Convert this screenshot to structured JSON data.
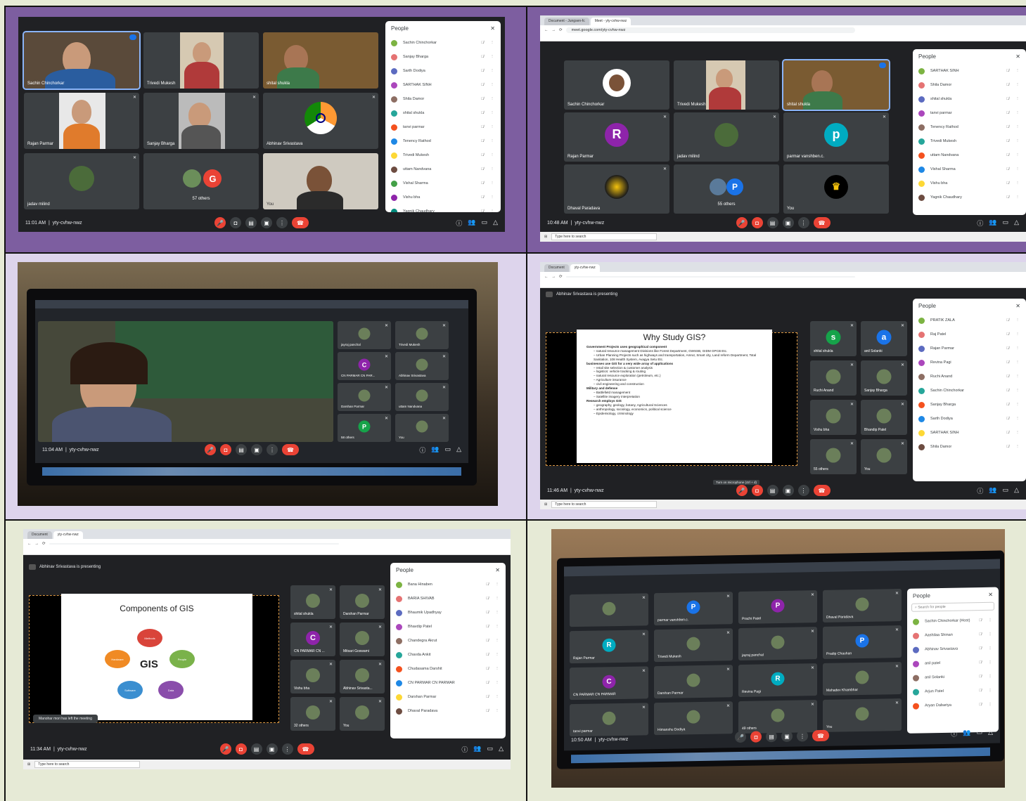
{
  "panel1": {
    "clock": "11:01 AM",
    "code": "yty-cvhw-nwz",
    "tiles": [
      {
        "name": "Sachin Chinchorkar"
      },
      {
        "name": "Trivedi Mukesh"
      },
      {
        "name": "shital shukla"
      },
      {
        "name": "Rajan Parmar"
      },
      {
        "name": "Sanjay Bharga"
      },
      {
        "name": "Abhinav Srivastava"
      },
      {
        "name": "jadav milind"
      },
      {
        "name": "57 others",
        "letter": "G"
      },
      {
        "name": "You"
      }
    ],
    "people_title": "People",
    "people": [
      {
        "name": "Sachin Chinchorkar"
      },
      {
        "name": "Sanjay Bharga"
      },
      {
        "name": "Sarth Dodiya"
      },
      {
        "name": "SARTHAK SINH"
      },
      {
        "name": "Shila Damor"
      },
      {
        "name": "shital shukla"
      },
      {
        "name": "tanvi parmar"
      },
      {
        "name": "Tenency Rathod"
      },
      {
        "name": "Trivedi Mukesh"
      },
      {
        "name": "uttam Nandvana"
      },
      {
        "name": "Vishal Sharma"
      },
      {
        "name": "Vishu bha"
      },
      {
        "name": "Yagnik Chaudhary"
      }
    ]
  },
  "panel2": {
    "clock": "10:48 AM",
    "code": "yty-cvhw-nwz",
    "tab1": "Document - Jungsen-fc",
    "tab2": "Meet - yty-cvhw-nwz",
    "url": "meet.google.com/yty-cvhw-nwz",
    "tiles": [
      {
        "name": "Sachin Chinchorkar"
      },
      {
        "name": "Trivedi Mukesh"
      },
      {
        "name": "shital shukla"
      },
      {
        "name": "Rajan Parmar",
        "letter": "R"
      },
      {
        "name": "jadav milind"
      },
      {
        "name": "parmar vanshben.c.",
        "letter": "p"
      },
      {
        "name": "Dhaval Paradava"
      },
      {
        "name": "55 others",
        "letter": "P"
      },
      {
        "name": "You"
      }
    ],
    "people_title": "People",
    "people": [
      {
        "name": "SARTHAK SINH"
      },
      {
        "name": "Shila Damor"
      },
      {
        "name": "shital shukla"
      },
      {
        "name": "tanvi parmar"
      },
      {
        "name": "Tenency Rathod"
      },
      {
        "name": "Trivedi Mukesh"
      },
      {
        "name": "uttam Nandvana"
      },
      {
        "name": "Vishal Sharma"
      },
      {
        "name": "Vishu bha"
      },
      {
        "name": "Yagnik Chaudhary"
      }
    ],
    "search_placeholder": "Type here to search"
  },
  "panel3": {
    "clock": "11:04 AM",
    "code": "yty-cvhw-nwz",
    "tiles": [
      {
        "name": "jayraj panchal"
      },
      {
        "name": "Trivedi Mukesh"
      },
      {
        "name": "CN PARMAR CN PAR...",
        "letter": "C"
      },
      {
        "name": "Abhinav Srivastava"
      },
      {
        "name": "Darshan Parmar"
      },
      {
        "name": "uttam Nandvana"
      },
      {
        "name": "58 others",
        "letter": "P"
      },
      {
        "name": "You"
      }
    ]
  },
  "panel4": {
    "clock": "11:46 AM",
    "code": "yty-cvhw-nwz",
    "presenting": "Abhinav Srivastava is presenting",
    "slide_title": "Why Study GIS?",
    "slide_lines": [
      "Government Projects uses geographical component",
      "– natural resource management Divisions like Forest Department, GWSSB, GIDM GPCB Etc.",
      "– Urban Planning Projects such as highways and transportation, Amrut, Smart city, Land reform Department, Total Sanitation, 108 Health System, Avagya Setu Etc.",
      "businesses use GIS for a very wide array of applications",
      "– retail site selection & customer analysis",
      "– logistics: vehicle tracking & routing",
      "– natural resource exploration (petroleum, etc.)",
      "– Agriculture insurance",
      "– civil engineering and construction",
      "Military and defense",
      "– Battlefield management",
      "– Satellite imagery interpretation",
      "Research employs GIS",
      "– geography, geology, botany, Agricultural Sciences",
      "– anthropology, sociology, economics, political science",
      "– Epidemiology, criminology"
    ],
    "mic_tip": "Turn on microphone (ctrl + d)",
    "tiles": [
      {
        "name": "shital shukla",
        "letter": "s"
      },
      {
        "name": "anil Solanki",
        "letter": "a"
      },
      {
        "name": "Ruchi Anand"
      },
      {
        "name": "Sanjay Bharga"
      },
      {
        "name": "Vishu bha"
      },
      {
        "name": "Bhandip Patel"
      },
      {
        "name": "55 others"
      },
      {
        "name": "You"
      }
    ],
    "people_title": "People",
    "people": [
      {
        "name": "PRATIK ZALA"
      },
      {
        "name": "Raj Patel"
      },
      {
        "name": "Rajan Parmar"
      },
      {
        "name": "Revina Pagi"
      },
      {
        "name": "Ruchi Anand"
      },
      {
        "name": "Sachin Chinchorkar"
      },
      {
        "name": "Sanjay Bharga"
      },
      {
        "name": "Sarth Dodiya"
      },
      {
        "name": "SARTHAK SINH"
      },
      {
        "name": "Shila Damor"
      }
    ],
    "search_placeholder": "Type here to search"
  },
  "panel5": {
    "clock": "11:34 AM",
    "code": "yty-cvhw-nwz",
    "presenting": "Abhinav Srivastava is presenting",
    "slide_title": "Components of GIS",
    "center": "GIS",
    "nodes": [
      "Methods",
      "People",
      "Data",
      "Software",
      "Hardware"
    ],
    "left_msg": "Manohar mori has left the meeting",
    "tiles": [
      {
        "name": "shital shukla"
      },
      {
        "name": "Darshan Parmar"
      },
      {
        "name": "CN PARMAR CN ...",
        "letter": "C"
      },
      {
        "name": "Mitsari Goswami"
      },
      {
        "name": "Vishu bha"
      },
      {
        "name": "Abhinav Srivasta..."
      },
      {
        "name": "32 others"
      },
      {
        "name": "You"
      }
    ],
    "people_title": "People",
    "people": [
      {
        "name": "Bana Hinaben"
      },
      {
        "name": "BARIA SHIVAB"
      },
      {
        "name": "Bhaumik Upadhyay"
      },
      {
        "name": "Bhavdip Patel"
      },
      {
        "name": "Chandegra Akrut"
      },
      {
        "name": "Chavda Ankit"
      },
      {
        "name": "Chudasama Darshit"
      },
      {
        "name": "CN PARMAR CN PARMAR"
      },
      {
        "name": "Darshan Parmar"
      },
      {
        "name": "Dhaval Paradava"
      }
    ],
    "search_placeholder": "Type here to search"
  },
  "panel6": {
    "clock": "10:50 AM",
    "code": "yty-cvhw-nwz",
    "tiles": [
      {
        "name": ""
      },
      {
        "name": "parmar vanshben.c.",
        "letter": "P"
      },
      {
        "name": "Prachi Patel",
        "letter": "P"
      },
      {
        "name": "Dhaval Paradava"
      },
      {
        "name": "Rajan Parmar",
        "letter": "R"
      },
      {
        "name": "Trivedi Mukesh"
      },
      {
        "name": "jayraj panchal"
      },
      {
        "name": "Pradip Chauhan",
        "letter": "P"
      },
      {
        "name": "CN PARMAR CN PARMAR",
        "letter": "C"
      },
      {
        "name": "Darshan Parmar"
      },
      {
        "name": "Revina Pagi",
        "letter": "R"
      },
      {
        "name": "Mahadev Khambhar"
      },
      {
        "name": "tanvi parmar"
      },
      {
        "name": "Himanshu Dodiya"
      },
      {
        "name": "49 others"
      },
      {
        "name": "You"
      }
    ],
    "people_title": "People",
    "search_placeholder": "Search for people",
    "people": [
      {
        "name": "Sachin Chinchorkar (Host)"
      },
      {
        "name": "Aashilaa Shinan"
      },
      {
        "name": "Abhinav Srivastava"
      },
      {
        "name": "anil patel"
      },
      {
        "name": "anil Solanki"
      },
      {
        "name": "Arjun Patel"
      },
      {
        "name": "Aryan Dabariya"
      }
    ]
  }
}
